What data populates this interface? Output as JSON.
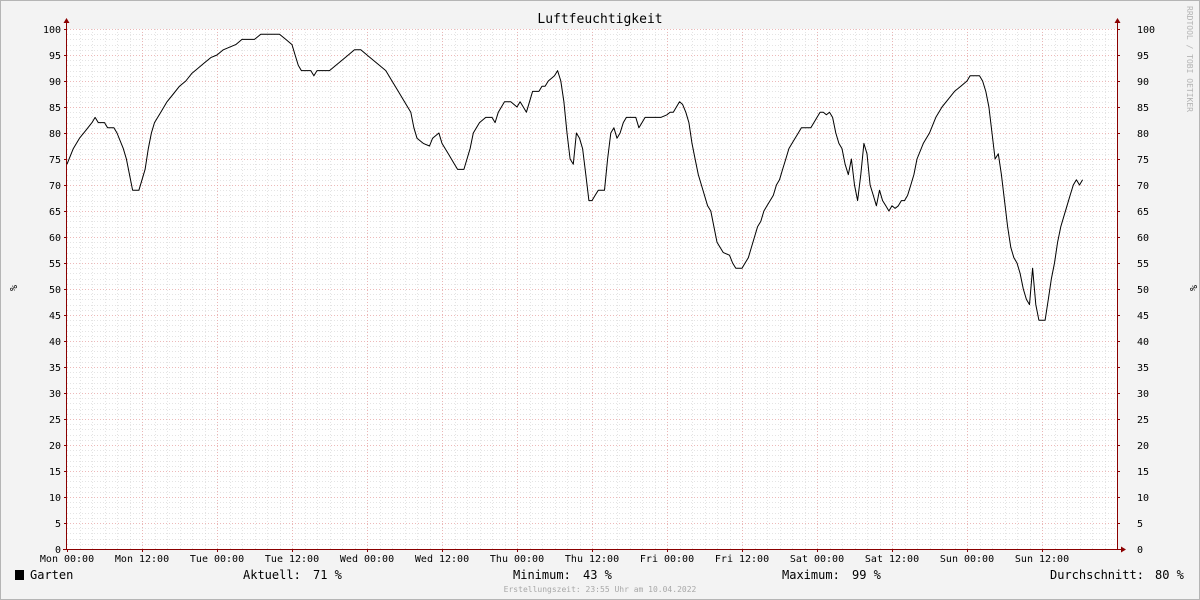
{
  "chart_data": {
    "type": "line",
    "title": "Luftfeuchtigkeit",
    "ylabel": "%",
    "ylim": [
      0,
      100
    ],
    "y_ticks": [
      0,
      5,
      10,
      15,
      20,
      25,
      30,
      35,
      40,
      45,
      50,
      55,
      60,
      65,
      70,
      75,
      80,
      85,
      90,
      95,
      100
    ],
    "x_tick_labels": [
      "Mon 00:00",
      "Mon 12:00",
      "Tue 00:00",
      "Tue 12:00",
      "Wed 00:00",
      "Wed 12:00",
      "Thu 00:00",
      "Thu 12:00",
      "Fri 00:00",
      "Fri 12:00",
      "Sat 00:00",
      "Sat 12:00",
      "Sun 00:00",
      "Sun 12:00"
    ],
    "x_unit": "hours since Mon 00:00",
    "xlim": [
      0,
      168
    ],
    "grid": true,
    "series": [
      {
        "name": "Garten",
        "color": "#000000",
        "points": [
          [
            0,
            74
          ],
          [
            1,
            77
          ],
          [
            2,
            79
          ],
          [
            3,
            80.5
          ],
          [
            4,
            82
          ],
          [
            4.5,
            83
          ],
          [
            5,
            82
          ],
          [
            6,
            82
          ],
          [
            6.5,
            81
          ],
          [
            7.5,
            81
          ],
          [
            8,
            80
          ],
          [
            9,
            77
          ],
          [
            9.5,
            75
          ],
          [
            10,
            72
          ],
          [
            10.5,
            69
          ],
          [
            11.5,
            69
          ],
          [
            12,
            71
          ],
          [
            12.5,
            73
          ],
          [
            13,
            77
          ],
          [
            13.5,
            80
          ],
          [
            14,
            82
          ],
          [
            15,
            84
          ],
          [
            16,
            86
          ],
          [
            17,
            87.5
          ],
          [
            18,
            89
          ],
          [
            19,
            90
          ],
          [
            20,
            91.5
          ],
          [
            21,
            92.5
          ],
          [
            22,
            93.5
          ],
          [
            23,
            94.5
          ],
          [
            24,
            95
          ],
          [
            25,
            96
          ],
          [
            26,
            96.5
          ],
          [
            27,
            97
          ],
          [
            28,
            98
          ],
          [
            30,
            98
          ],
          [
            31,
            99
          ],
          [
            34,
            99
          ],
          [
            35,
            98
          ],
          [
            36,
            97
          ],
          [
            36.5,
            95
          ],
          [
            37,
            93
          ],
          [
            37.5,
            92
          ],
          [
            39,
            92
          ],
          [
            39.5,
            91
          ],
          [
            40,
            92
          ],
          [
            42,
            92
          ],
          [
            43,
            93
          ],
          [
            44,
            94
          ],
          [
            45,
            95
          ],
          [
            46,
            96
          ],
          [
            47,
            96
          ],
          [
            48,
            95
          ],
          [
            49,
            94
          ],
          [
            50,
            93
          ],
          [
            51,
            92
          ],
          [
            52,
            90
          ],
          [
            53,
            88
          ],
          [
            54,
            86
          ],
          [
            55,
            84
          ],
          [
            55.5,
            81
          ],
          [
            56,
            79
          ],
          [
            57,
            78
          ],
          [
            58,
            77.5
          ],
          [
            58.5,
            79
          ],
          [
            59.5,
            80
          ],
          [
            60,
            78
          ],
          [
            61,
            76
          ],
          [
            62,
            74
          ],
          [
            62.5,
            73
          ],
          [
            63.5,
            73
          ],
          [
            64,
            75
          ],
          [
            64.5,
            77
          ],
          [
            65,
            80
          ],
          [
            66,
            82
          ],
          [
            67,
            83
          ],
          [
            68,
            83
          ],
          [
            68.5,
            82
          ],
          [
            69,
            84
          ],
          [
            70,
            86
          ],
          [
            71,
            86
          ],
          [
            72,
            85
          ],
          [
            72.5,
            86
          ],
          [
            73,
            85
          ],
          [
            73.5,
            84
          ],
          [
            74,
            86
          ],
          [
            74.5,
            88
          ],
          [
            75.5,
            88
          ],
          [
            76,
            89
          ],
          [
            76.5,
            89
          ],
          [
            77,
            90
          ],
          [
            78,
            91
          ],
          [
            78.5,
            92
          ],
          [
            79,
            90
          ],
          [
            79.5,
            86
          ],
          [
            80,
            80
          ],
          [
            80.5,
            75
          ],
          [
            81,
            74
          ],
          [
            81.5,
            80
          ],
          [
            82,
            79
          ],
          [
            82.5,
            77
          ],
          [
            83,
            72
          ],
          [
            83.5,
            67
          ],
          [
            84,
            67
          ],
          [
            84.5,
            68
          ],
          [
            85,
            69
          ],
          [
            86,
            69
          ],
          [
            86.5,
            75
          ],
          [
            87,
            80
          ],
          [
            87.5,
            81
          ],
          [
            88,
            79
          ],
          [
            88.5,
            80
          ],
          [
            89,
            82
          ],
          [
            89.5,
            83
          ],
          [
            90,
            83
          ],
          [
            91,
            83
          ],
          [
            91.5,
            81
          ],
          [
            92,
            82
          ],
          [
            92.5,
            83
          ],
          [
            93,
            83
          ],
          [
            95,
            83
          ],
          [
            96,
            83.5
          ],
          [
            96.5,
            84
          ],
          [
            97,
            84
          ],
          [
            97.5,
            85
          ],
          [
            98,
            86
          ],
          [
            98.5,
            85.5
          ],
          [
            99,
            84
          ],
          [
            99.5,
            82
          ],
          [
            100,
            78
          ],
          [
            100.5,
            75
          ],
          [
            101,
            72
          ],
          [
            101.5,
            70
          ],
          [
            102,
            68
          ],
          [
            102.5,
            66
          ],
          [
            103,
            65
          ],
          [
            103.5,
            62
          ],
          [
            104,
            59
          ],
          [
            104.5,
            58
          ],
          [
            105,
            57
          ],
          [
            106,
            56.5
          ],
          [
            106.5,
            55
          ],
          [
            107,
            54
          ],
          [
            108,
            54
          ],
          [
            108.5,
            55
          ],
          [
            109,
            56
          ],
          [
            109.5,
            58
          ],
          [
            110,
            60
          ],
          [
            110.5,
            62
          ],
          [
            111,
            63
          ],
          [
            111.5,
            65
          ],
          [
            112,
            66
          ],
          [
            113,
            68
          ],
          [
            113.5,
            70
          ],
          [
            114,
            71
          ],
          [
            114.5,
            73
          ],
          [
            115,
            75
          ],
          [
            115.5,
            77
          ],
          [
            116,
            78
          ],
          [
            116.5,
            79
          ],
          [
            117,
            80
          ],
          [
            117.5,
            81
          ],
          [
            119,
            81
          ],
          [
            119.5,
            82
          ],
          [
            120,
            83
          ],
          [
            120.5,
            84
          ],
          [
            121,
            84
          ],
          [
            121.5,
            83.5
          ],
          [
            122,
            84
          ],
          [
            122.5,
            83
          ],
          [
            123,
            80
          ],
          [
            123.5,
            78
          ],
          [
            124,
            77
          ],
          [
            124.5,
            74
          ],
          [
            125,
            72
          ],
          [
            125.5,
            75
          ],
          [
            126,
            70
          ],
          [
            126.5,
            67
          ],
          [
            127,
            72
          ],
          [
            127.5,
            78
          ],
          [
            128,
            76
          ],
          [
            128.5,
            70
          ],
          [
            129,
            68
          ],
          [
            129.5,
            66
          ],
          [
            130,
            69
          ],
          [
            130.5,
            67
          ],
          [
            131,
            66
          ],
          [
            131.5,
            65
          ],
          [
            132,
            66
          ],
          [
            132.5,
            65.5
          ],
          [
            133,
            66
          ],
          [
            133.5,
            67
          ],
          [
            134,
            67
          ],
          [
            134.5,
            68
          ],
          [
            135,
            70
          ],
          [
            135.5,
            72
          ],
          [
            136,
            75
          ],
          [
            137,
            78
          ],
          [
            138,
            80
          ],
          [
            139,
            83
          ],
          [
            140,
            85
          ],
          [
            141,
            86.5
          ],
          [
            142,
            88
          ],
          [
            143,
            89
          ],
          [
            144,
            90
          ],
          [
            144.5,
            91
          ],
          [
            146,
            91
          ],
          [
            146.5,
            90
          ],
          [
            147,
            88
          ],
          [
            147.5,
            85
          ],
          [
            148,
            80
          ],
          [
            148.5,
            75
          ],
          [
            149,
            76
          ],
          [
            149.5,
            72
          ],
          [
            150,
            67
          ],
          [
            150.5,
            62
          ],
          [
            151,
            58
          ],
          [
            151.5,
            56
          ],
          [
            152,
            55
          ],
          [
            152.5,
            53
          ],
          [
            153,
            50
          ],
          [
            153.5,
            48
          ],
          [
            154,
            47
          ],
          [
            154.5,
            54
          ],
          [
            155,
            47
          ],
          [
            155.5,
            44
          ],
          [
            156.5,
            44
          ],
          [
            157,
            48
          ],
          [
            157.5,
            52
          ],
          [
            158,
            55
          ],
          [
            158.5,
            59
          ],
          [
            159,
            62
          ],
          [
            159.5,
            64
          ],
          [
            160,
            66
          ],
          [
            160.5,
            68
          ],
          [
            161,
            70
          ],
          [
            161.5,
            71
          ],
          [
            162,
            70
          ],
          [
            162.5,
            71
          ]
        ]
      }
    ]
  },
  "legend": {
    "series_label": "Garten",
    "swatch_color": "#000000",
    "current_label": "Aktuell:",
    "current_value": "71 %",
    "min_label": "Minimum:",
    "min_value": "43 %",
    "max_label": "Maximum:",
    "max_value": "99 %",
    "avg_label": "Durchschnitt:",
    "avg_value": "80 %"
  },
  "footer": {
    "timestamp": "Erstellungszeit: 23:55 Uhr am 10.04.2022"
  },
  "watermark": "RRDTOOL / TOBI OETIKER",
  "colors": {
    "background": "#f3f3f3",
    "plot_background": "#ffffff",
    "major_grid": "#e7a3a3",
    "minor_grid": "#c9c9c9",
    "axis": "#8b0000",
    "line": "#000000"
  }
}
